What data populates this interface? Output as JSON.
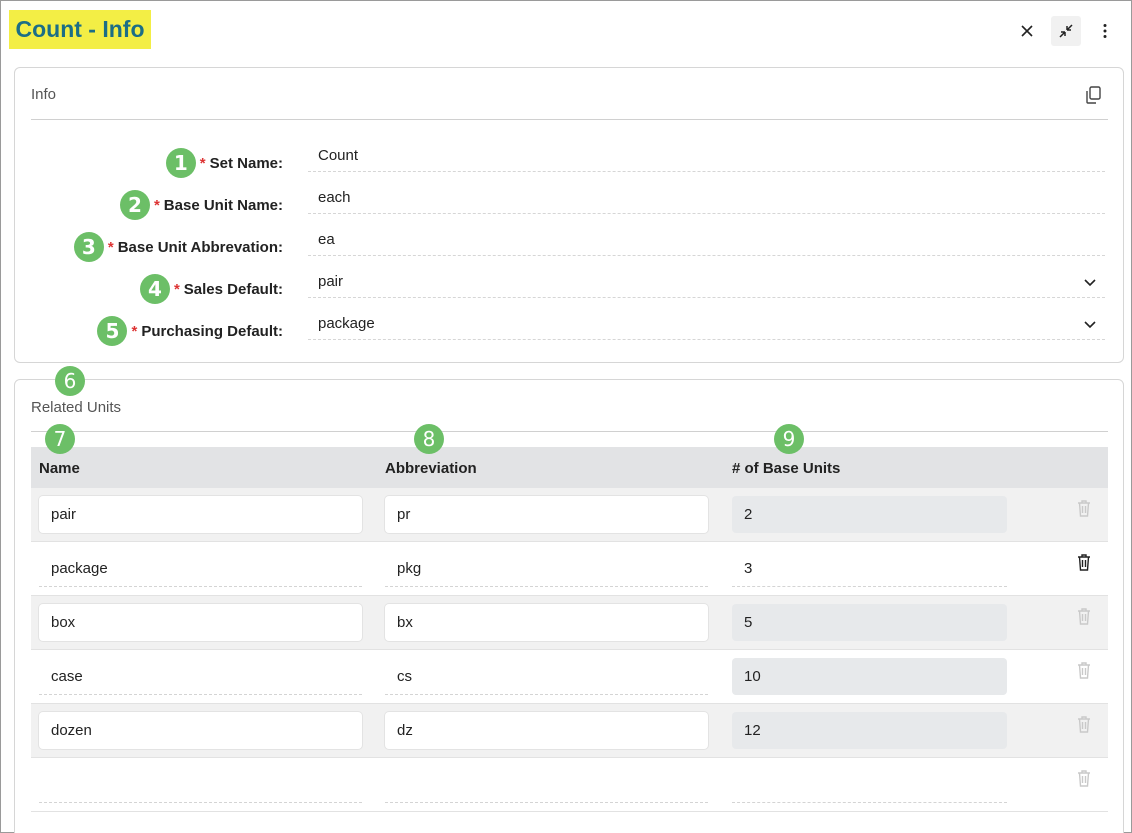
{
  "window": {
    "title": "Count - Info",
    "close_label": "×",
    "more_label": "⋮"
  },
  "info": {
    "title": "Info",
    "fields": [
      {
        "marker": "1",
        "label": "Set Name:",
        "required": "*",
        "value": "Count"
      },
      {
        "marker": "2",
        "label": "Base Unit Name:",
        "required": "*",
        "value": "each"
      },
      {
        "marker": "3",
        "label": "Base Unit Abbrevation:",
        "required": "*",
        "value": "ea"
      },
      {
        "marker": "4",
        "label": "Sales Default:",
        "required": "*",
        "value": "pair"
      },
      {
        "marker": "5",
        "label": "Purchasing Default:",
        "required": "*",
        "value": "package"
      }
    ]
  },
  "related_units": {
    "marker": "6",
    "title": "Related Units",
    "columns": [
      {
        "marker": "7",
        "label": "Name"
      },
      {
        "marker": "8",
        "label": "Abbreviation"
      },
      {
        "marker": "9",
        "label": "# of Base Units"
      }
    ],
    "rows": [
      {
        "name": "pair",
        "abbreviation": "pr",
        "base_units": "2"
      },
      {
        "name": "package",
        "abbreviation": "pkg",
        "base_units": "3"
      },
      {
        "name": "box",
        "abbreviation": "bx",
        "base_units": "5"
      },
      {
        "name": "case",
        "abbreviation": "cs",
        "base_units": "10"
      },
      {
        "name": "dozen",
        "abbreviation": "dz",
        "base_units": "12"
      },
      {
        "name": "",
        "abbreviation": "",
        "base_units": ""
      }
    ]
  },
  "colors": {
    "title_highlight": "#f3ee45",
    "title_text": "#1b6e86",
    "marker": "#6cbf67",
    "required": "#dd3333",
    "header_bg": "#e2e3e5"
  },
  "icons": {
    "close": "close-icon",
    "collapse": "collapse-icon",
    "more": "more-vertical-icon",
    "copy": "copy-icon",
    "chevron": "chevron-down-icon",
    "delete": "trash-icon"
  }
}
